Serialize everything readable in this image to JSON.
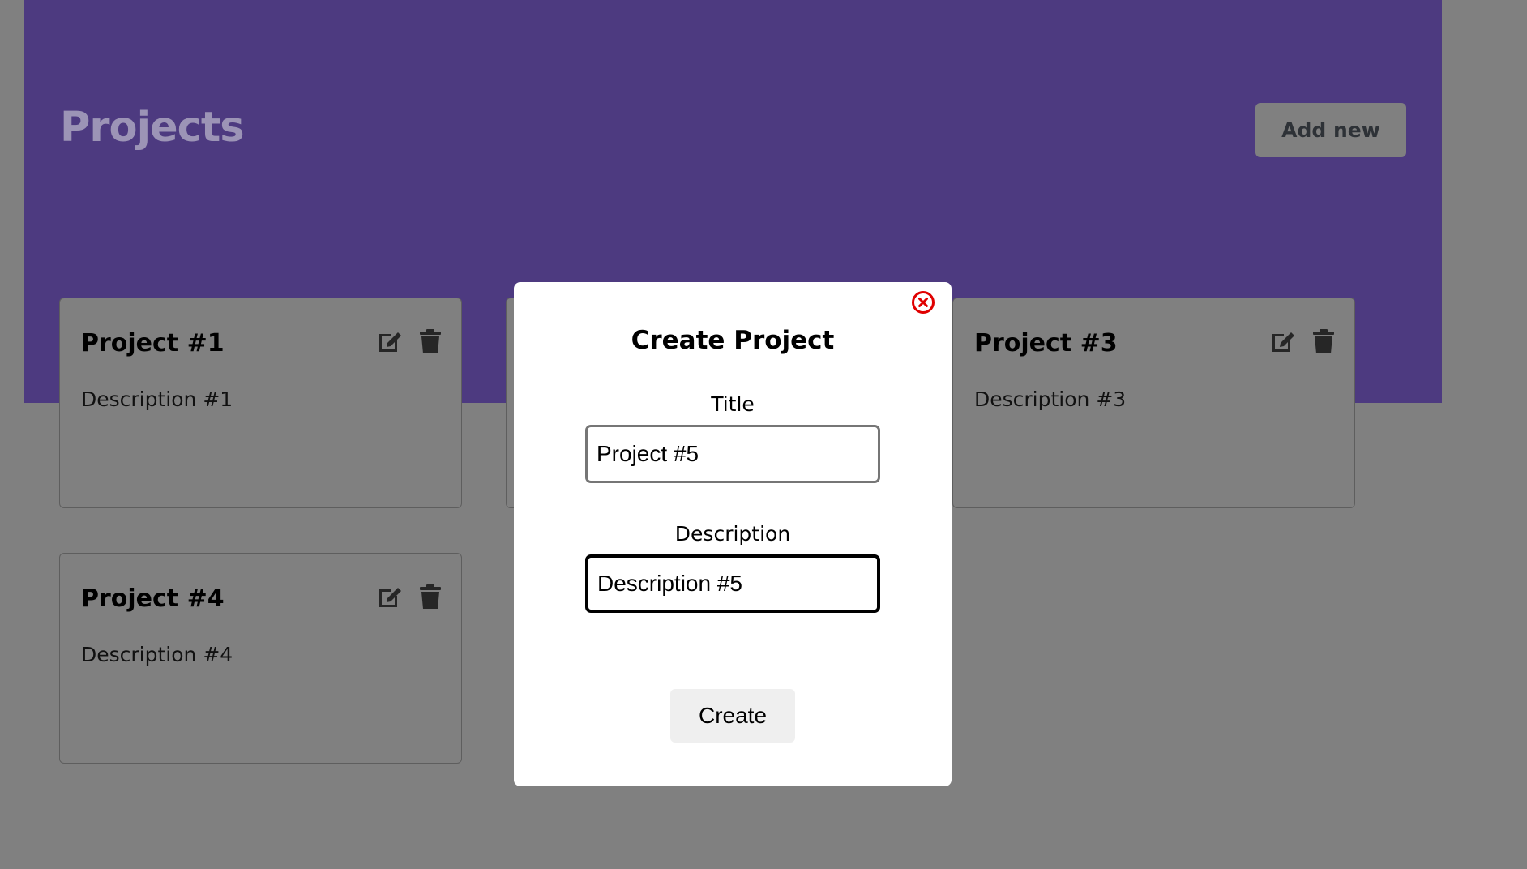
{
  "header": {
    "title": "Projects",
    "add_new_label": "Add new"
  },
  "projects": [
    {
      "title": "Project #1",
      "description": "Description #1"
    },
    {
      "title": "",
      "description": ""
    },
    {
      "title": "Project #3",
      "description": "Description #3"
    },
    {
      "title": "Project #4",
      "description": "Description #4"
    }
  ],
  "icons": {
    "edit": "edit-icon",
    "delete": "trash-icon",
    "close": "close-circle-icon"
  },
  "modal": {
    "title": "Create Project",
    "title_label": "Title",
    "title_value": "Project #5",
    "description_label": "Description",
    "description_value": "Description #5",
    "create_label": "Create"
  },
  "colors": {
    "header_bg": "#4d3a80",
    "overlay": "#808080",
    "close_icon": "#e00000"
  }
}
